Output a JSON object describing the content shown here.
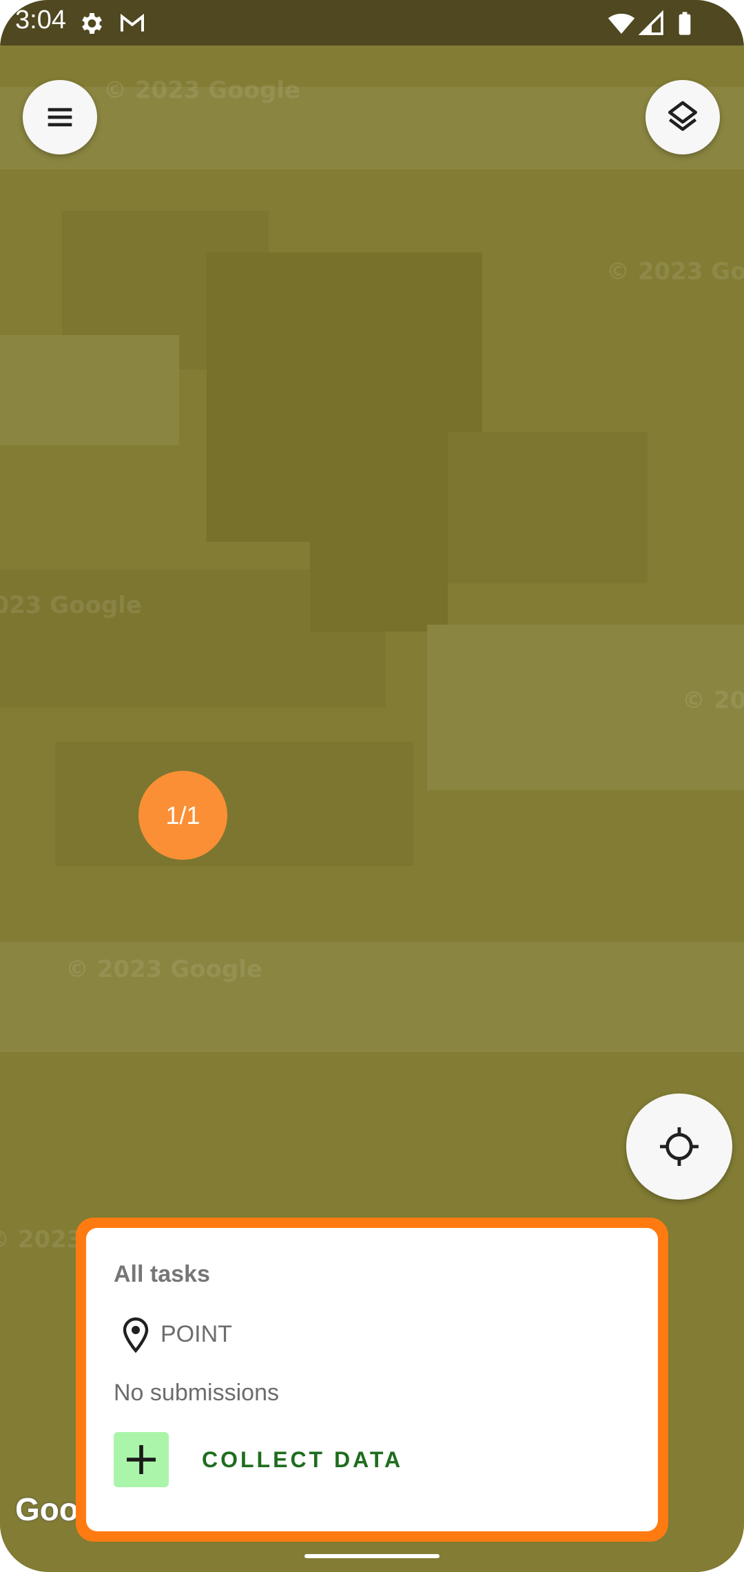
{
  "status_bar": {
    "time": "3:04",
    "icons": [
      "settings-icon",
      "gmail-icon",
      "wifi-icon",
      "signal-icon",
      "battery-icon"
    ]
  },
  "map": {
    "watermark_text": "© 2023 Google",
    "attribution": "Goo",
    "cluster_label": "1/1"
  },
  "controls": {
    "menu_icon": "menu-icon",
    "layers_icon": "layers-icon",
    "location_icon": "my-location-icon"
  },
  "card": {
    "title": "All tasks",
    "geometry_icon": "map-pin-icon",
    "geometry_label": "POINT",
    "submissions": "No submissions",
    "collect_icon": "plus-icon",
    "collect_label": "COLLECT DATA"
  },
  "colors": {
    "map": "#827c34",
    "status_bar": "#4f4820",
    "cluster": "#fb8f35",
    "card_border": "#ff7b12",
    "collect_bg": "#aaf5aa",
    "collect_text": "#1f6d1f"
  }
}
